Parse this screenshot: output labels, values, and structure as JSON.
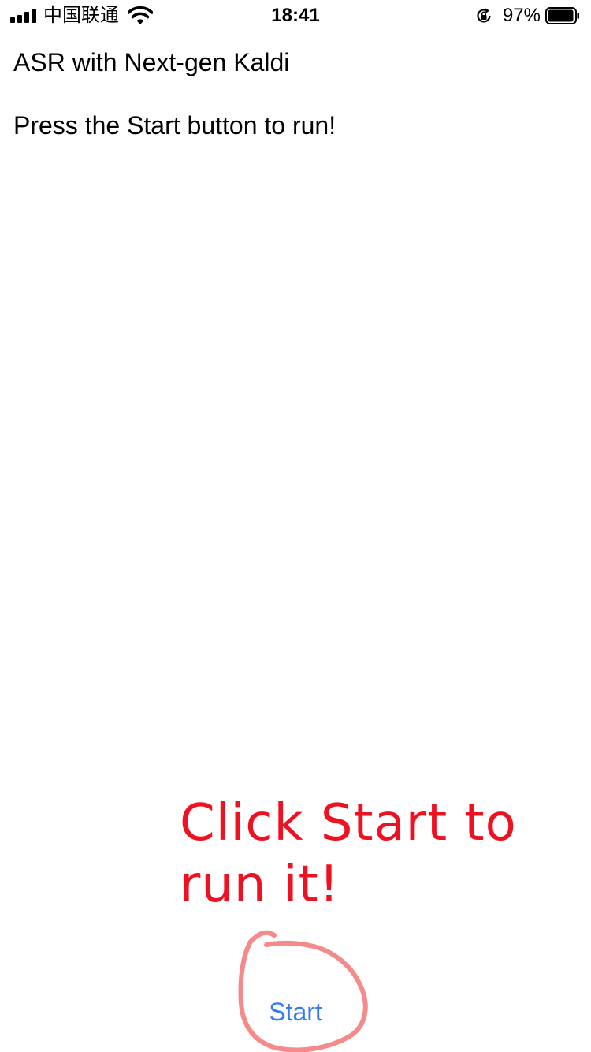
{
  "status_bar": {
    "carrier": "中国联通",
    "time": "18:41",
    "battery_percent": "97%",
    "battery_level": 0.97,
    "icons": [
      "signal-icon",
      "wifi-icon",
      "orientation-lock-icon",
      "battery-icon"
    ]
  },
  "app": {
    "title": "ASR with Next-gen Kaldi",
    "status_message": "Press the Start button to run!",
    "start_label": "Start"
  },
  "annotation": {
    "text": "Click Start to run it!",
    "color": "#ee1122",
    "circle_color": "#f48a8a"
  },
  "colors": {
    "accent": "#3478f6",
    "background": "#ffffff",
    "text": "#000000"
  }
}
